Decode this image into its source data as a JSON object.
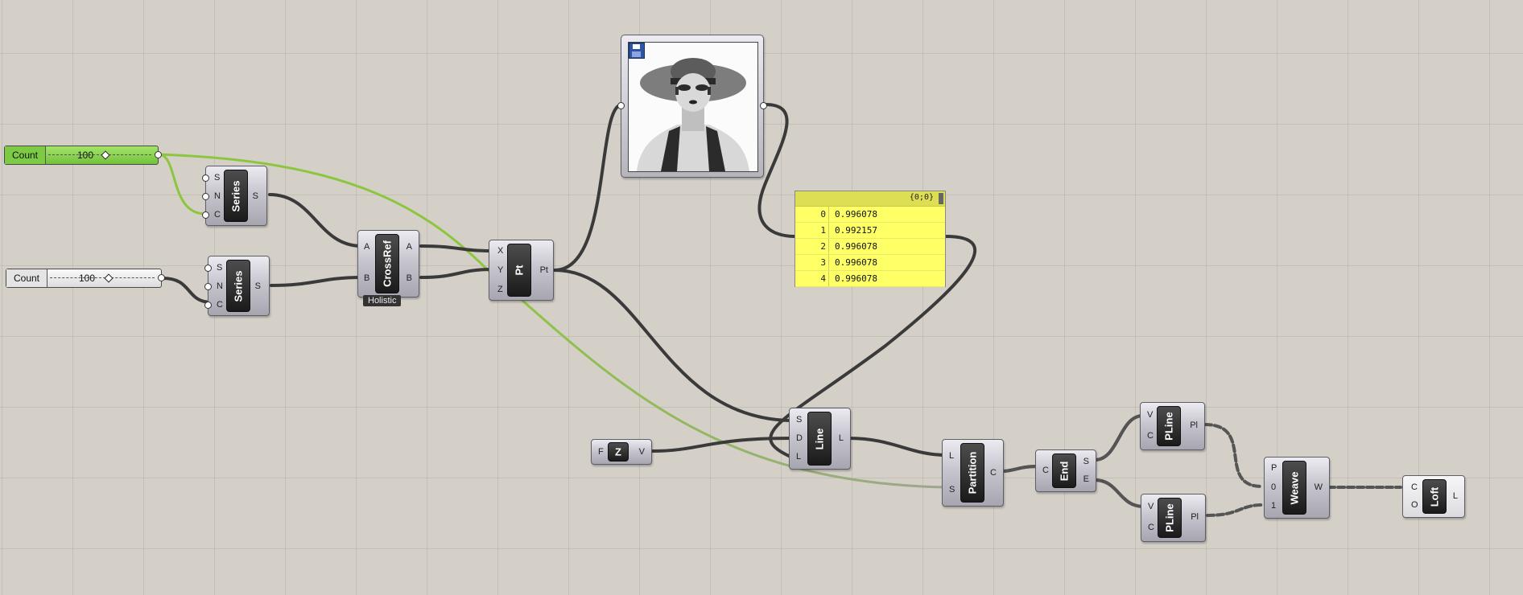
{
  "sliders": [
    {
      "label": "Count",
      "value": "100",
      "active": true
    },
    {
      "label": "Count",
      "value": "100",
      "active": false
    }
  ],
  "components": {
    "series1": {
      "name": "Series",
      "inputs": [
        "S",
        "N",
        "C"
      ],
      "outputs": [
        "S"
      ]
    },
    "series2": {
      "name": "Series",
      "inputs": [
        "S",
        "N",
        "C"
      ],
      "outputs": [
        "S"
      ]
    },
    "crossref": {
      "name": "CrossRef",
      "inputs": [
        "A",
        "B"
      ],
      "outputs": [
        "A",
        "B"
      ],
      "badge": "Holistic"
    },
    "pt": {
      "name": "Pt",
      "inputs": [
        "X",
        "Y",
        "Z"
      ],
      "outputs": [
        "Pt"
      ]
    },
    "z": {
      "name": "Z",
      "inputs": [
        "F"
      ],
      "outputs": [
        "V"
      ]
    },
    "line": {
      "name": "Line",
      "inputs": [
        "S",
        "D",
        "L"
      ],
      "outputs": [
        "L"
      ]
    },
    "partition": {
      "name": "Partition",
      "inputs": [
        "L",
        "S"
      ],
      "outputs": [
        "C"
      ]
    },
    "end": {
      "name": "End",
      "inputs": [
        "C"
      ],
      "outputs": [
        "S",
        "E"
      ]
    },
    "pline1": {
      "name": "PLine",
      "inputs": [
        "V",
        "C"
      ],
      "outputs": [
        "Pl"
      ]
    },
    "pline2": {
      "name": "PLine",
      "inputs": [
        "V",
        "C"
      ],
      "outputs": [
        "Pl"
      ]
    },
    "weave": {
      "name": "Weave",
      "inputs": [
        "P",
        "0",
        "1"
      ],
      "outputs": [
        "W"
      ]
    },
    "loft": {
      "name": "Loft",
      "inputs": [
        "C",
        "O"
      ],
      "outputs": [
        "L"
      ]
    }
  },
  "panel": {
    "path": "{0;0}",
    "rows": [
      {
        "i": "0",
        "v": "0.996078"
      },
      {
        "i": "1",
        "v": "0.992157"
      },
      {
        "i": "2",
        "v": "0.996078"
      },
      {
        "i": "3",
        "v": "0.996078"
      },
      {
        "i": "4",
        "v": "0.996078"
      }
    ]
  },
  "image_sampler": {
    "icon": "save-disk-icon"
  },
  "colors": {
    "slider_active": "#8fd14f",
    "wire_green": "#8cc63f",
    "panel_yellow": "#ffff66",
    "wire_dark": "#3a3a3a"
  }
}
